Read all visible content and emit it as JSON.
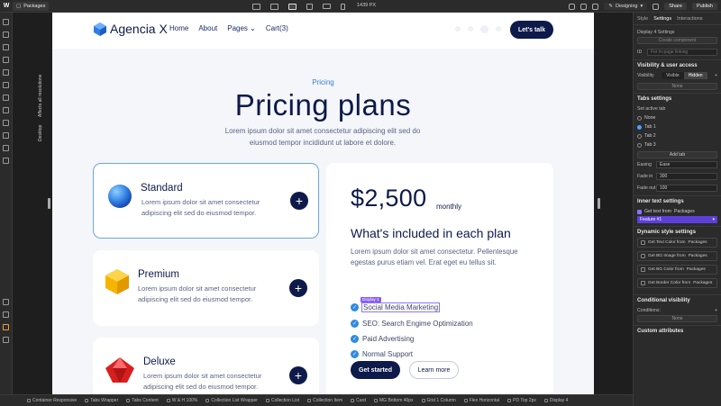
{
  "topbar": {
    "page": "Packages",
    "px": "1439 PX",
    "mode": "Designing",
    "share": "Share",
    "publish": "Publish"
  },
  "canvas_labels": {
    "affects": "Affects all resolutions",
    "desktop": "Desktop"
  },
  "site": {
    "brand": "Agencia X",
    "nav": [
      "Home",
      "About",
      "Pages",
      "Cart(3)"
    ],
    "cta": "Let's talk",
    "eyebrow": "Pricing",
    "title": "Pricing plans",
    "subtitle": "Lorem ipsum dolor sit amet consectetur adipiscing elit sed do eiusmod tempor incididunt ut labore et dolore.",
    "plans": [
      {
        "name": "Standard",
        "desc": "Lorem ipsum dolor sit amet consectetur adipiscing elit sed do eiusmod tempor."
      },
      {
        "name": "Premium",
        "desc": "Lorem ipsum dolor sit amet consectetur adipiscing elit sed do eiusmod tempor."
      },
      {
        "name": "Deluxe",
        "desc": "Lorem ipsum dolor sit amet consectetur adipiscing elit sed do eiusmod tempor."
      }
    ],
    "price": "$2,500",
    "price_unit": "monthly",
    "included_title": "What's included in each plan",
    "included_desc": "Lorem ipsum dolor sit amet consectetur. Pellentesque egestas purus etiam vel. Erat eget eu tellus sit.",
    "features": [
      "Social Media Marketing",
      "SEO: Search Engime Optimization",
      "Paid Advertising",
      "Normal Support"
    ],
    "display_tag": "Display 4",
    "get_started": "Get started",
    "learn_more": "Learn more"
  },
  "panel": {
    "tabs": [
      "Style",
      "Settings",
      "Interactions"
    ],
    "settings_title": "Display 4 Settings",
    "create_component": "Create component",
    "id_label": "ID",
    "id_placeholder": "For in-page linking",
    "vis_title": "Visibility & user access",
    "vis_label": "Visibility",
    "vis_visible": "Visible",
    "vis_hidden": "Hidden",
    "none1": "None",
    "tabs_title": "Tabs settings",
    "active_tab": "Set active tab",
    "tab_none": "None",
    "tab_items": [
      "Tab 1",
      "Tab 2",
      "Tab 3"
    ],
    "add_tab": "Add tab",
    "easing_label": "Easing",
    "easing_val": "Ease",
    "fadein_label": "Fade in",
    "fadein_val": "300",
    "fadeout_label": "Fade out",
    "fadeout_val": "100",
    "inner_title": "Inner text settings",
    "get_text": "Get text from",
    "get_text_src": "Packages",
    "feature_val": "Feature #1",
    "dyn_title": "Dynamic style settings",
    "dyn_items": [
      "Get Text Color from",
      "Get BG Image from",
      "Get BG Color from",
      "Get Border Color from"
    ],
    "dyn_src": "Packages",
    "cond_title": "Conditional visibility",
    "conditions_label": "Conditions:",
    "none2": "None",
    "custom_attr": "Custom attributes"
  },
  "breadcrumbs": [
    "Container Responsive",
    "Tabs Wrapper",
    "Tabs Content",
    "W & H 100%",
    "Collection List Wrapper",
    "Collection List",
    "Collection Item",
    "Card",
    "MG Bottom 40px",
    "Grid 1 Column",
    "Flex Horizontal",
    "PD Top 2px",
    "Display 4"
  ],
  "colors": {
    "brand": "#0d1a4a",
    "accent": "#2f7de1",
    "editor_bg": "#2b2b2b",
    "selection": "#8a72ff"
  }
}
